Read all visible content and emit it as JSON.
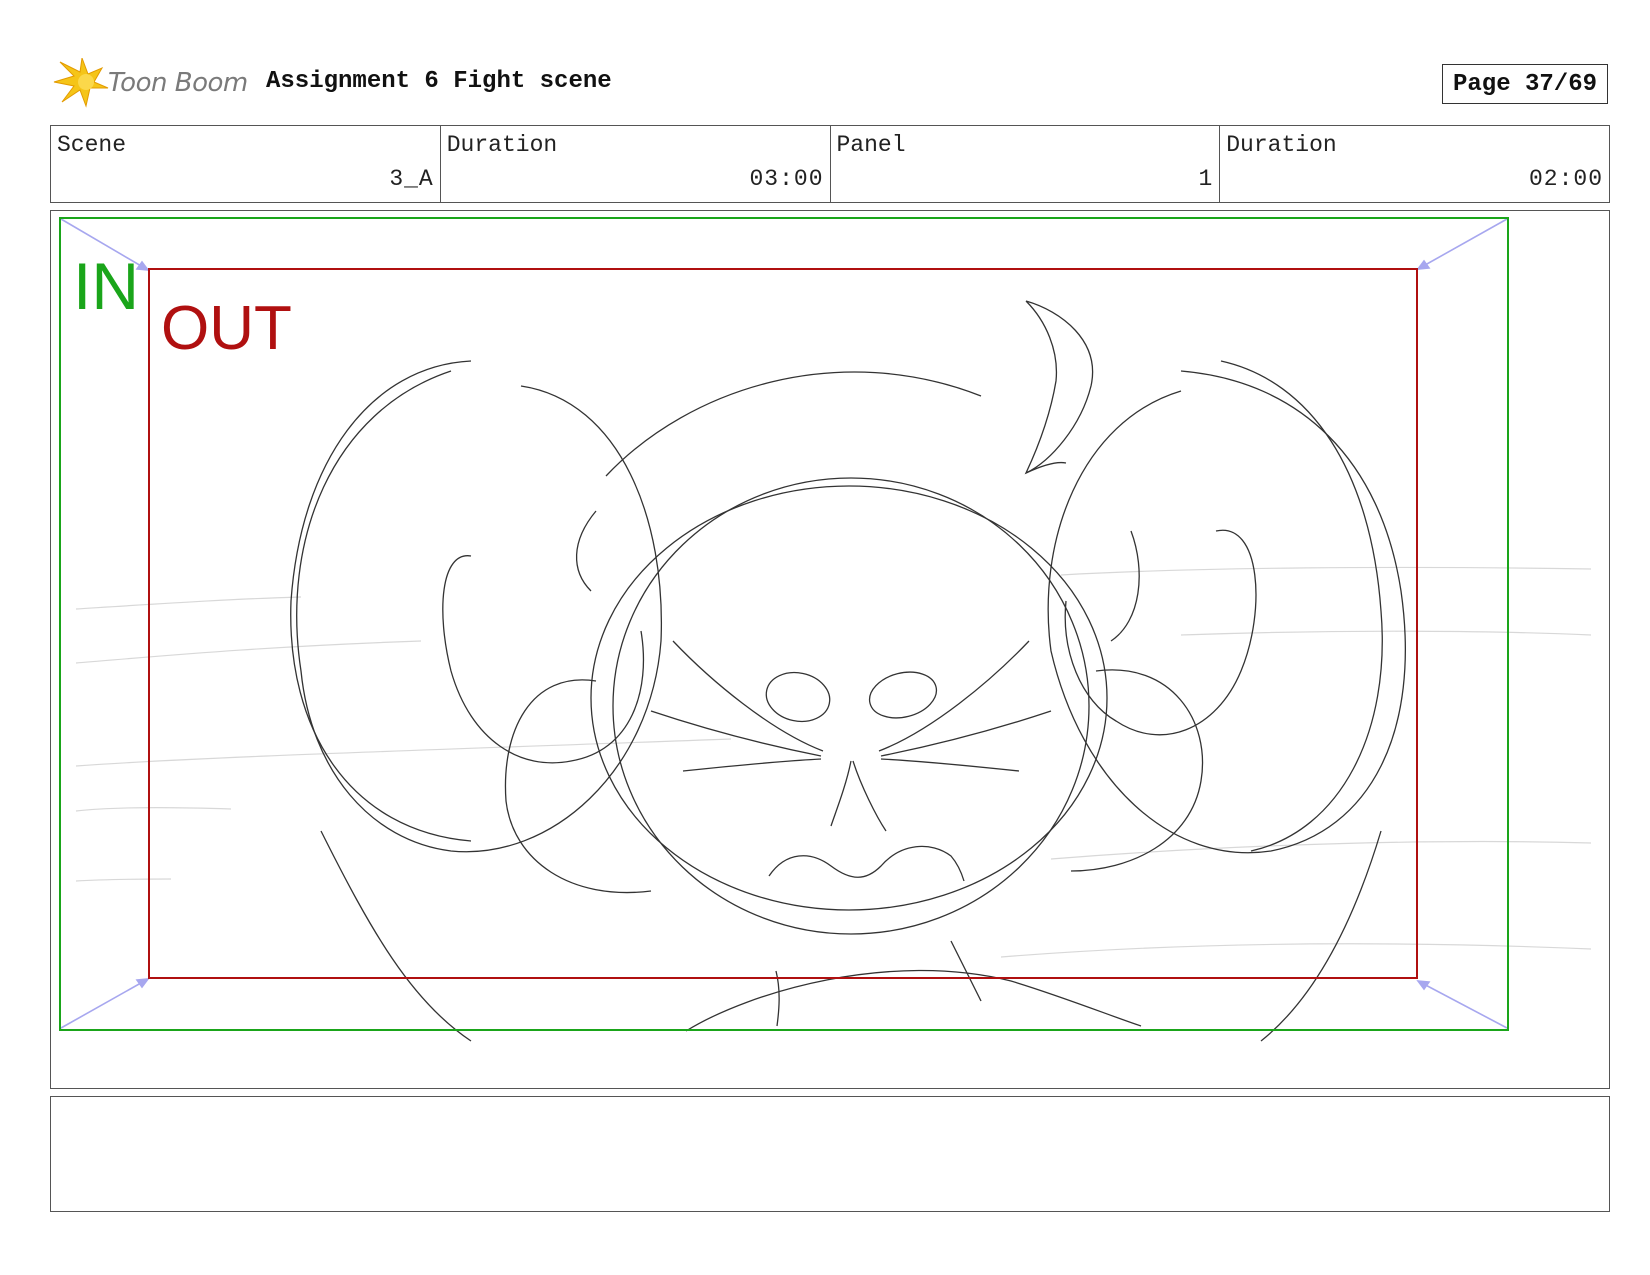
{
  "header": {
    "logo_text": "Toon Boom",
    "title": "Assignment 6 Fight scene",
    "page": "Page 37/69"
  },
  "info": {
    "scene_label": "Scene",
    "scene_value": "3_A",
    "scene_duration_label": "Duration",
    "scene_duration_value": "03:00",
    "panel_label": "Panel",
    "panel_value": "1",
    "panel_duration_label": "Duration",
    "panel_duration_value": "02:00"
  },
  "panel": {
    "in_label": "IN",
    "out_label": "OUT",
    "colors": {
      "in": "#1aa51a",
      "out": "#b01010",
      "camera_arrow": "#a7a7ef",
      "sketch": "#333333"
    }
  },
  "notes": {
    "text": ""
  },
  "icons": [
    "toon-boom-logo"
  ]
}
